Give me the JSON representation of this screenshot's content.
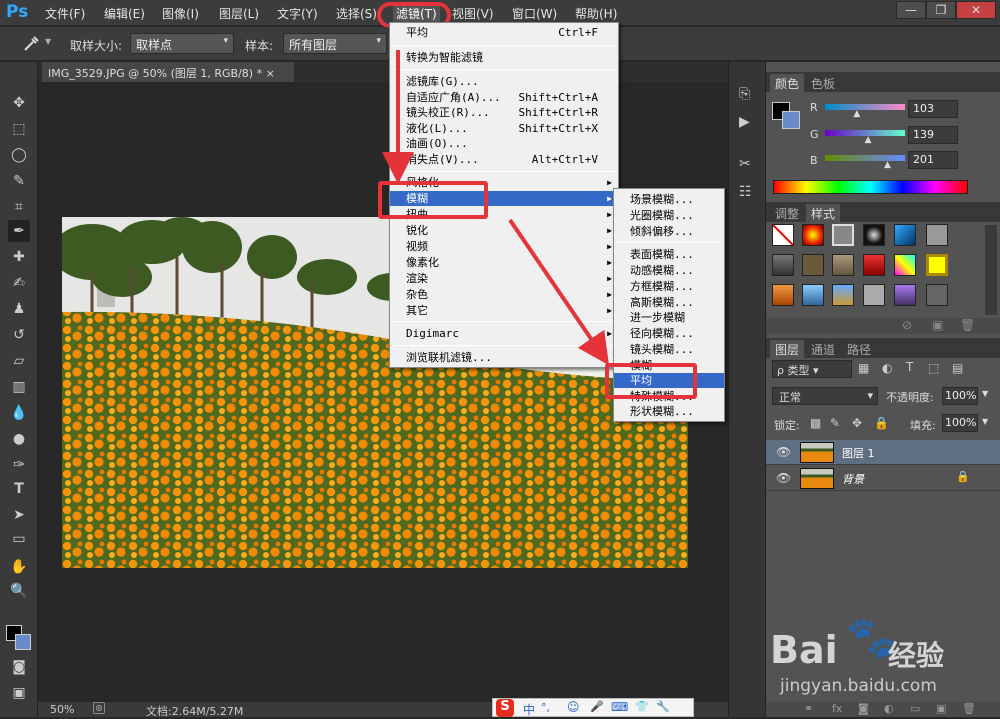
{
  "app": {
    "logo": "Ps"
  },
  "menubar": [
    "文件(F)",
    "编辑(E)",
    "图像(I)",
    "图层(L)",
    "文字(Y)",
    "选择(S)",
    "滤镜(T)",
    "视图(V)",
    "窗口(W)",
    "帮助(H)"
  ],
  "window_buttons": [
    "—",
    "❐",
    "✕"
  ],
  "options": {
    "sample_size_label": "取样大小:",
    "sample_size_value": "取样点",
    "sample_label": "样本:",
    "sample_value": "所有图层"
  },
  "document": {
    "tab_title": "IMG_3529.JPG @ 50% (图层 1, RGB/8) *",
    "close": "×"
  },
  "filter_menu": {
    "items": [
      {
        "label": "平均",
        "shortcut": "Ctrl+F"
      },
      {
        "label": "转换为智能滤镜"
      },
      {
        "label": "滤镜库(G)..."
      },
      {
        "label": "自适应广角(A)...",
        "shortcut": "Shift+Ctrl+A"
      },
      {
        "label": "镜头校正(R)...",
        "shortcut": "Shift+Ctrl+R"
      },
      {
        "label": "液化(L)...",
        "shortcut": "Shift+Ctrl+X"
      },
      {
        "label": "油画(O)..."
      },
      {
        "label": "消失点(V)...",
        "shortcut": "Alt+Ctrl+V"
      },
      {
        "label": "风格化"
      },
      {
        "label": "模糊"
      },
      {
        "label": "扭曲"
      },
      {
        "label": "锐化"
      },
      {
        "label": "视频"
      },
      {
        "label": "像素化"
      },
      {
        "label": "渲染"
      },
      {
        "label": "杂色"
      },
      {
        "label": "其它"
      },
      {
        "label": "Digimarc"
      },
      {
        "label": "浏览联机滤镜..."
      }
    ]
  },
  "blur_menu": {
    "items": [
      "场景模糊...",
      "光圈模糊...",
      "倾斜偏移...",
      "表面模糊...",
      "动感模糊...",
      "方框模糊...",
      "高斯模糊...",
      "进一步模糊",
      "径向模糊...",
      "镜头模糊...",
      "模糊",
      "平均",
      "特殊模糊...",
      "形状模糊..."
    ]
  },
  "color_panel": {
    "tabs": [
      "颜色",
      "色板"
    ],
    "r_label": "R",
    "g_label": "G",
    "b_label": "B",
    "r": "103",
    "g": "139",
    "b": "201",
    "r_frac": 0.404,
    "g_frac": 0.545,
    "b_frac": 0.788
  },
  "styles_panel": {
    "tabs": [
      "调整",
      "样式"
    ]
  },
  "layers_panel": {
    "tabs": [
      "图层",
      "通道",
      "路径"
    ],
    "filter_kind": "ρ 类型",
    "blend_mode": "正常",
    "opacity_label": "不透明度:",
    "opacity_value": "100%",
    "lock_label": "锁定:",
    "fill_label": "填充:",
    "fill_value": "100%",
    "layers": [
      {
        "name": "图层 1"
      },
      {
        "name": "背景"
      }
    ]
  },
  "status": {
    "zoom": "50%",
    "doc_info": "文档:2.64M/5.27M"
  },
  "ime": [
    "中",
    "°,",
    "☺",
    "🎤",
    "⌨",
    "👕",
    "🔧"
  ],
  "watermark": {
    "brand": "Bai",
    "brand2": "经验",
    "url": "jingyan.baidu.com"
  },
  "colors": {
    "highlight": "#3469c7",
    "annotation_red": "#e5333a",
    "ps_blue": "#31a8ff"
  }
}
